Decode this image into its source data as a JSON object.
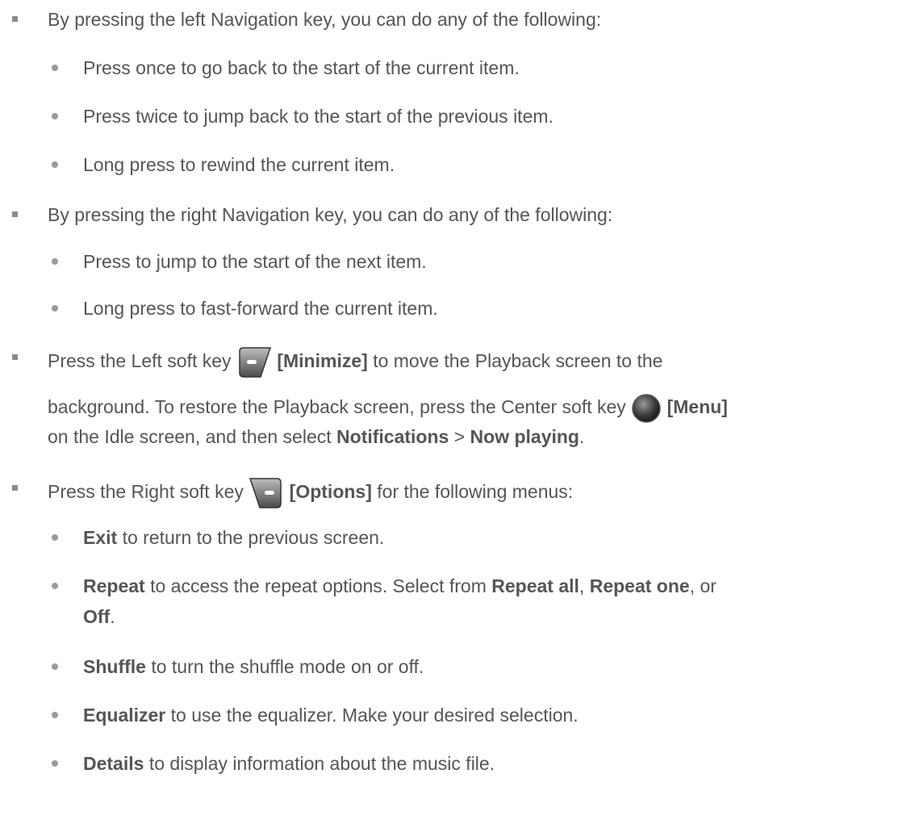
{
  "items": {
    "b1": "By pressing the left Navigation key, you can do any of the following:",
    "b1_1": "Press once to go back to the start of the current item.",
    "b1_2": "Press twice to jump back to the start of the previous item.",
    "b1_3": "Long press to rewind the current item.",
    "b2": "By pressing the right Navigation key, you can do any of the following:",
    "b2_1": "Press to jump to the start of the next item.",
    "b2_2": "Long press to fast-forward the current item.",
    "b3_pre": "Press the Left soft key",
    "b3_key": "[Minimize]",
    "b3_post": "to move the Playback screen to the",
    "b3_l2_pre": "background. To restore the Playback screen, press the Center soft key",
    "b3_l2_key": "[Menu]",
    "b3_l3_pre": "on the Idle screen, and then select",
    "b3_l3_notif": "Notifications",
    "b3_l3_sep": ">",
    "b3_l3_now": "Now playing",
    "b3_l3_end": ".",
    "b4_pre": "Press the Right soft key",
    "b4_key": "[Options]",
    "b4_post": "for the following menus:",
    "exit_b": "Exit",
    "exit_t": "to return to the previous screen.",
    "repeat_b": "Repeat",
    "repeat_t": "to access the repeat options. Select from",
    "repeat_all": "Repeat all",
    "comma": ",",
    "repeat_one": "Repeat one",
    "repeat_or": ", or",
    "off": "Off",
    "period": ".",
    "shuffle_b": "Shuffle",
    "shuffle_t": "to turn the shuffle mode on or off.",
    "eq_b": "Equalizer",
    "eq_t": "to use the equalizer. Make your desired selection.",
    "details_b": "Details",
    "details_t": "to display information about the music file."
  }
}
